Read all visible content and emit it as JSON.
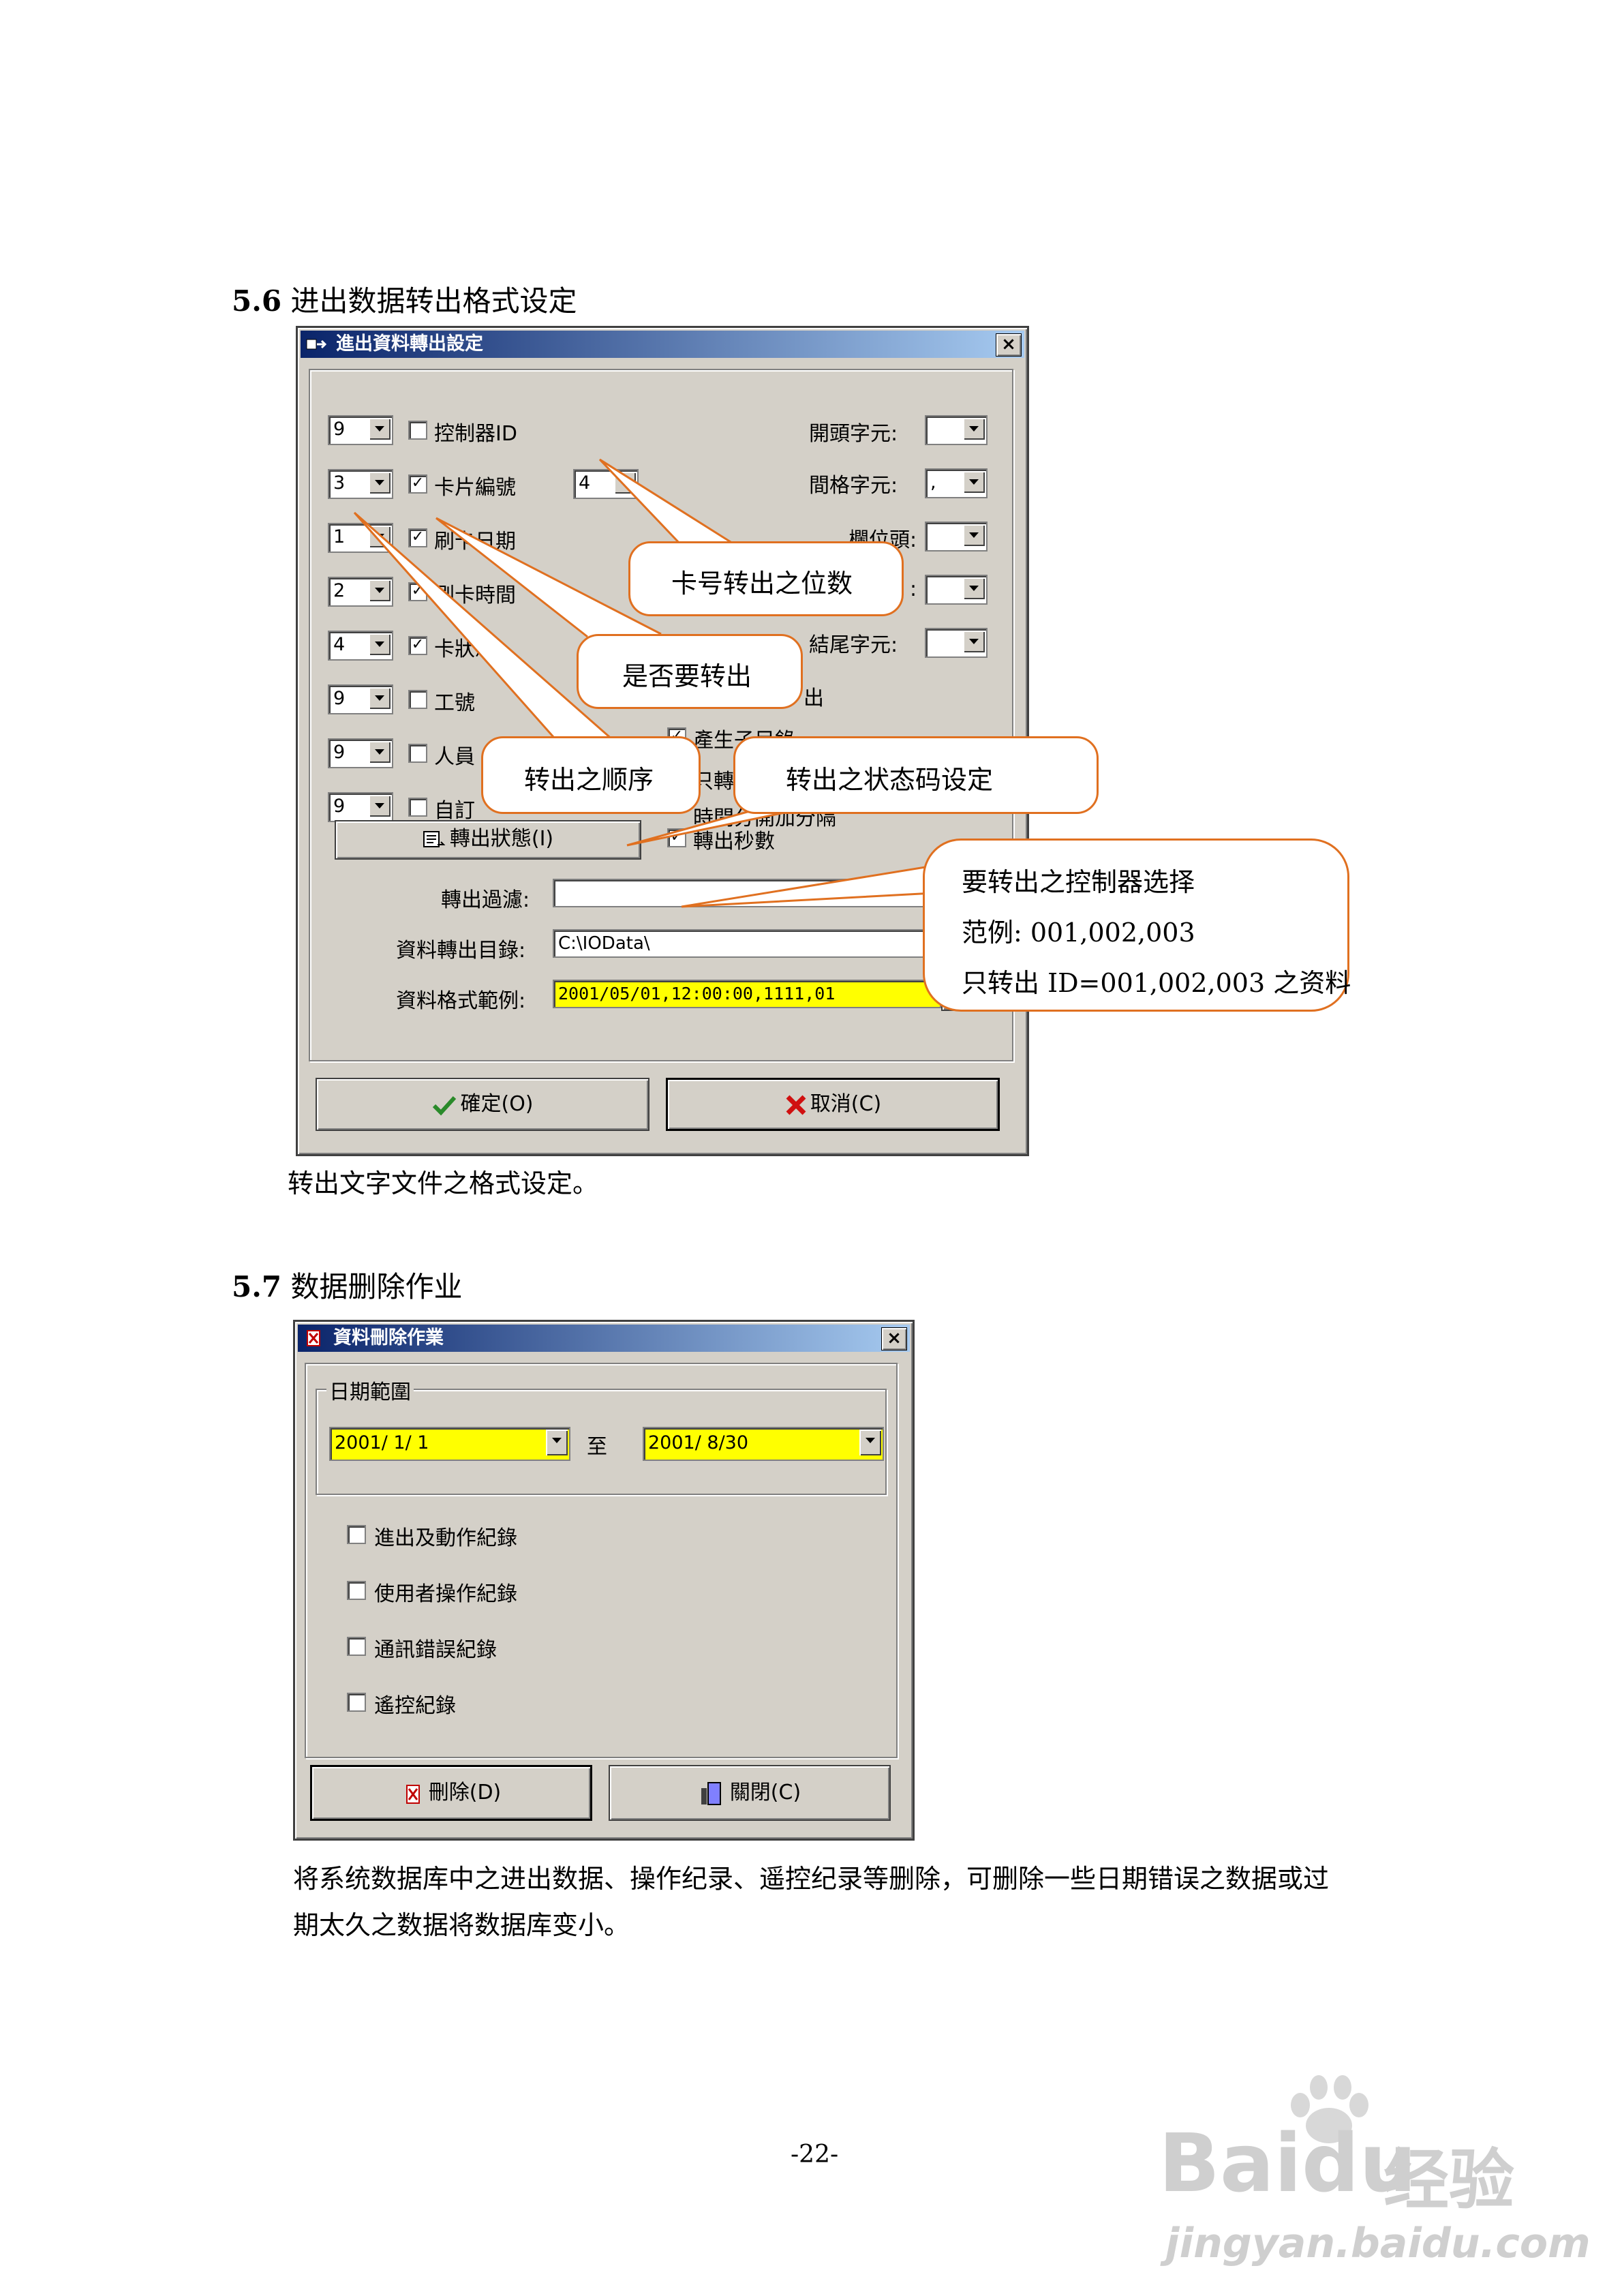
{
  "section1": {
    "heading_number": "5.6",
    "heading_text": "进出数据转出格式设定",
    "caption": "转出文字文件之格式设定。"
  },
  "export_dialog": {
    "title": "進出資料轉出設定",
    "close": "×",
    "fields": [
      {
        "order": "9",
        "checked": false,
        "label": "控制器ID"
      },
      {
        "order": "3",
        "checked": true,
        "label": "卡片編號"
      },
      {
        "order": "1",
        "checked": true,
        "label": "刷卡日期"
      },
      {
        "order": "2",
        "checked": true,
        "label": "刷卡時間"
      },
      {
        "order": "4",
        "checked": true,
        "label": "卡狀態"
      },
      {
        "order": "9",
        "checked": false,
        "label": "工號"
      },
      {
        "order": "9",
        "checked": false,
        "label": "人員"
      },
      {
        "order": "9",
        "checked": false,
        "label": "自訂"
      }
    ],
    "card_digits": "4",
    "right_labels": {
      "start_char": "開頭字元:",
      "sep_char": "間格字元:",
      "sep_value": ",",
      "col_head": "欄位頭:",
      "col_tail": ":",
      "end_char": "結尾字元:"
    },
    "right_options": {
      "opt1_partial": "出",
      "opt2": "產生子目錄",
      "opt3": "只轉出有效",
      "opt4": "時間分開加分隔",
      "export_seconds": "轉出秒數"
    },
    "status_button": "轉出狀態(I)",
    "filter_label": "轉出過濾:",
    "filter_value": "",
    "dir_label": "資料轉出目錄:",
    "dir_value": "C:\\IOData\\",
    "sample_label": "資料格式範例:",
    "sample_value": "2001/05/01,12:00:00,1111,01",
    "ok_button": "確定(O)",
    "cancel_button": "取消(C)"
  },
  "callouts": {
    "digits": "卡号转出之位数",
    "export_or_not": "是否要转出",
    "order": "转出之顺序",
    "status_code": "转出之状态码设定",
    "controller_line1": "要转出之控制器选择",
    "controller_line2": "范例: 001,002,003",
    "controller_line3": "只转出 ID=001,002,003 之资料"
  },
  "section2": {
    "heading_number": "5.7",
    "heading_text": "数据删除作业",
    "para_line1": "将系统数据库中之进出数据、操作纪录、遥控纪录等删除，可删除一些日期错误之数据或过",
    "para_line2": "期太久之数据将数据库变小。"
  },
  "delete_dialog": {
    "title": "資料刪除作業",
    "close": "×",
    "group_label": "日期範圍",
    "date_from": "2001/ 1/ 1",
    "to_label": "至",
    "date_to": "2001/ 8/30",
    "options": [
      "進出及動作紀錄",
      "使用者操作紀錄",
      "通訊錯誤紀錄",
      "遙控紀錄"
    ],
    "delete_button": "刪除(D)",
    "close_button": "關閉(C)"
  },
  "page_number": "-22-",
  "watermark": {
    "brand": "Bai",
    "brand2": "du",
    "suffix": "经验",
    "url": "jingyan.baidu.com"
  },
  "colors": {
    "highlight_yellow": "#ffff00",
    "callout_border": "#e07020",
    "dialog_face": "#d4d0c8"
  }
}
